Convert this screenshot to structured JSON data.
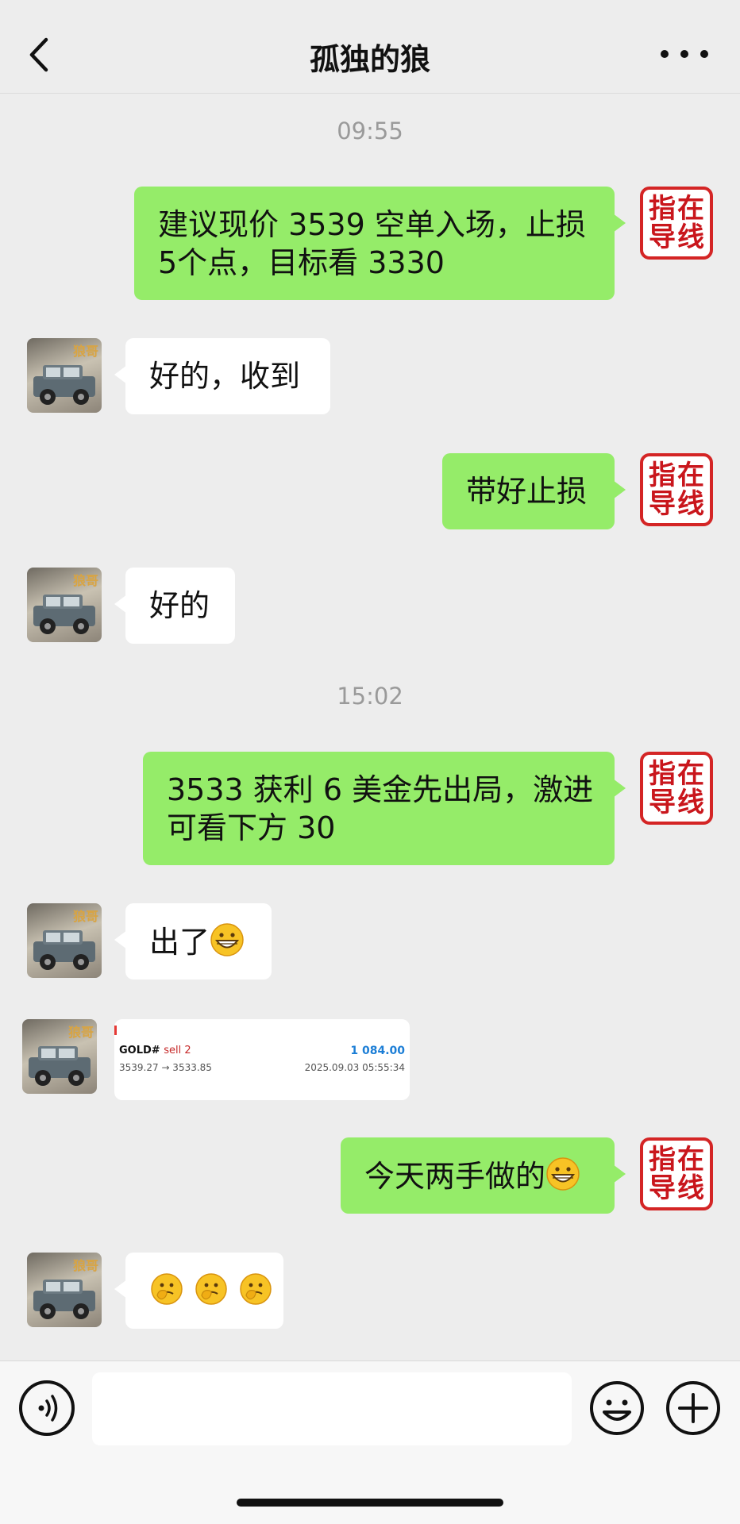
{
  "header": {
    "title": "孤独的狼",
    "back_icon": "chevron-left-icon",
    "more_icon": "more-horizontal-icon"
  },
  "timestamps": [
    "09:55",
    "15:02"
  ],
  "seal_text": [
    "指",
    "在",
    "导",
    "线"
  ],
  "messages": {
    "m1": {
      "direction": "out",
      "lines": [
        "建议现价 3539 空单入场，止损",
        "5个点，目标看 3330"
      ]
    },
    "m2": {
      "direction": "in",
      "text": "好的，收到"
    },
    "m3": {
      "direction": "out",
      "text": "带好止损"
    },
    "m4": {
      "direction": "in",
      "text": "好的"
    },
    "m5": {
      "direction": "out",
      "lines": [
        "3533 获利 6 美金先出局，激进",
        "可看下方 30"
      ]
    },
    "m6": {
      "direction": "in",
      "text": "出了",
      "emoji": "grinning-face"
    },
    "m7": {
      "direction": "in",
      "type": "trade-card"
    },
    "m8": {
      "direction": "out",
      "text": "今天两手做的",
      "emoji": "grinning-face"
    },
    "m9": {
      "direction": "in",
      "emoji": [
        "thinking-face",
        "thinking-face",
        "thinking-face"
      ]
    }
  },
  "trade_card": {
    "symbol": "GOLD#",
    "side": "sell 2",
    "profit": "1 084.00",
    "prices": "3539.27 → 3533.85",
    "time": "2025.09.03 05:55:34"
  },
  "input_bar": {
    "voice_icon": "voice-icon",
    "emoji_icon": "emoji-icon",
    "plus_icon": "plus-circle-icon",
    "input_value": ""
  },
  "colors": {
    "outgoing_bubble": "#95ec69",
    "incoming_bubble": "#ffffff",
    "background": "#ededed",
    "seal_red": "#c9161c",
    "profit_blue": "#1c7ed6"
  }
}
